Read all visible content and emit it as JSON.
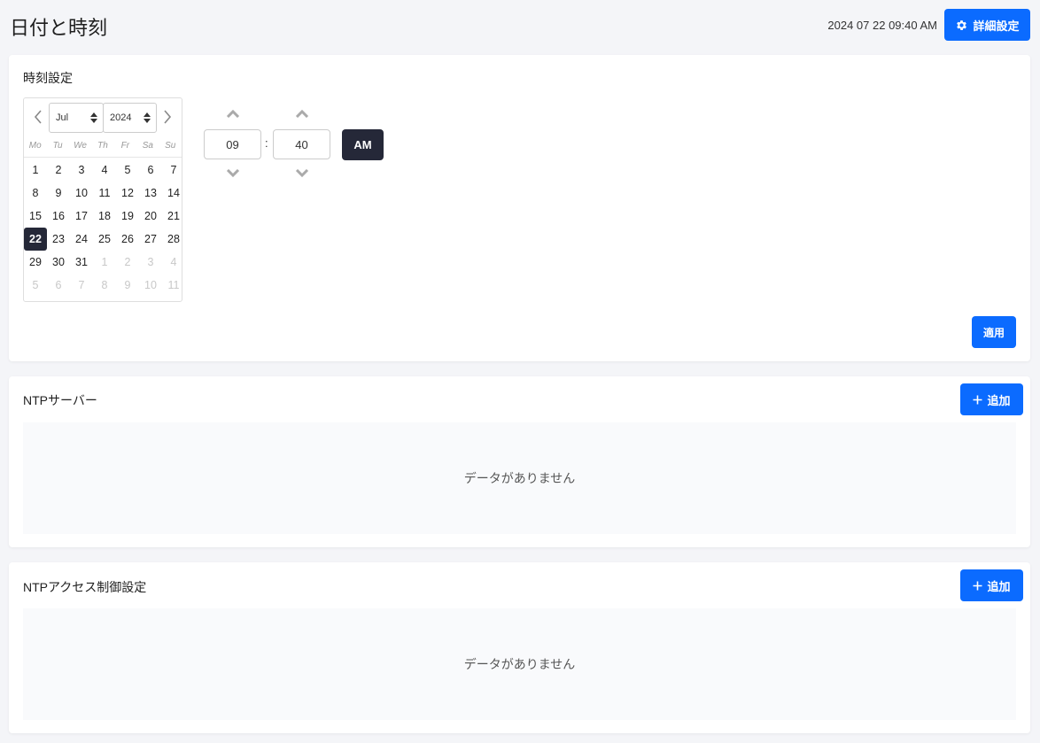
{
  "header": {
    "title": "日付と時刻",
    "datetime": "2024 07 22 09:40 AM",
    "settings_label": "詳細設定"
  },
  "time_settings": {
    "title": "時刻設定",
    "calendar": {
      "month": "Jul",
      "year": "2024",
      "weekdays": [
        "Mo",
        "Tu",
        "We",
        "Th",
        "Fr",
        "Sa",
        "Su"
      ],
      "days": [
        {
          "label": "1",
          "muted": false
        },
        {
          "label": "2",
          "muted": false
        },
        {
          "label": "3",
          "muted": false
        },
        {
          "label": "4",
          "muted": false
        },
        {
          "label": "5",
          "muted": false
        },
        {
          "label": "6",
          "muted": false
        },
        {
          "label": "7",
          "muted": false
        },
        {
          "label": "8",
          "muted": false
        },
        {
          "label": "9",
          "muted": false
        },
        {
          "label": "10",
          "muted": false
        },
        {
          "label": "11",
          "muted": false
        },
        {
          "label": "12",
          "muted": false
        },
        {
          "label": "13",
          "muted": false
        },
        {
          "label": "14",
          "muted": false
        },
        {
          "label": "15",
          "muted": false
        },
        {
          "label": "16",
          "muted": false
        },
        {
          "label": "17",
          "muted": false
        },
        {
          "label": "18",
          "muted": false
        },
        {
          "label": "19",
          "muted": false
        },
        {
          "label": "20",
          "muted": false
        },
        {
          "label": "21",
          "muted": false
        },
        {
          "label": "22",
          "muted": false,
          "selected": true
        },
        {
          "label": "23",
          "muted": false
        },
        {
          "label": "24",
          "muted": false
        },
        {
          "label": "25",
          "muted": false
        },
        {
          "label": "26",
          "muted": false
        },
        {
          "label": "27",
          "muted": false
        },
        {
          "label": "28",
          "muted": false
        },
        {
          "label": "29",
          "muted": false
        },
        {
          "label": "30",
          "muted": false
        },
        {
          "label": "31",
          "muted": false
        },
        {
          "label": "1",
          "muted": true
        },
        {
          "label": "2",
          "muted": true
        },
        {
          "label": "3",
          "muted": true
        },
        {
          "label": "4",
          "muted": true
        },
        {
          "label": "5",
          "muted": true
        },
        {
          "label": "6",
          "muted": true
        },
        {
          "label": "7",
          "muted": true
        },
        {
          "label": "8",
          "muted": true
        },
        {
          "label": "9",
          "muted": true
        },
        {
          "label": "10",
          "muted": true
        },
        {
          "label": "11",
          "muted": true
        }
      ]
    },
    "hour": "09",
    "minute": "40",
    "separator": ":",
    "ampm": "AM",
    "apply_label": "適用"
  },
  "ntp_servers": {
    "title": "NTPサーバー",
    "add_label": "追加",
    "empty_text": "データがありません"
  },
  "ntp_access": {
    "title": "NTPアクセス制御設定",
    "add_label": "追加",
    "empty_text": "データがありません"
  },
  "colors": {
    "primary": "#0b6bff",
    "dark": "#252838",
    "background": "#f4f5f8"
  },
  "icons": {
    "settings": "gear-icon",
    "add": "plus-icon",
    "prev": "chevron-left-icon",
    "next": "chevron-right-icon",
    "up": "chevron-up-icon",
    "down": "chevron-down-icon"
  }
}
